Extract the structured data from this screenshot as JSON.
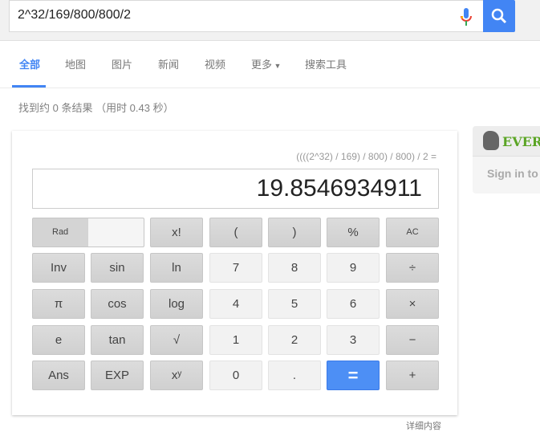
{
  "search": {
    "query": "2^32/169/800/800/2"
  },
  "tabs": [
    {
      "label": "全部"
    },
    {
      "label": "地图"
    },
    {
      "label": "图片"
    },
    {
      "label": "新闻"
    },
    {
      "label": "视频"
    },
    {
      "label": "更多"
    },
    {
      "label": "搜索工具"
    }
  ],
  "stats": "找到约 0 条结果 （用时 0.43 秒）",
  "calculator": {
    "expression": "((((2^32) / 169) / 800) / 800) / 2 =",
    "result": "19.8546934911",
    "keys": [
      [
        "Rad",
        "",
        "x!",
        "(",
        ")",
        "%",
        "AC"
      ],
      [
        "Inv",
        "sin",
        "ln",
        "7",
        "8",
        "9",
        "÷"
      ],
      [
        "π",
        "cos",
        "log",
        "4",
        "5",
        "6",
        "×"
      ],
      [
        "e",
        "tan",
        "√",
        "1",
        "2",
        "3",
        "−"
      ],
      [
        "Ans",
        "EXP",
        "xʸ",
        "0",
        ".",
        "=",
        "+"
      ]
    ],
    "accent": "#4d8ff5"
  },
  "footer": "详细内容",
  "evernote": {
    "brand": "EVERNOTE",
    "signin": "Sign in to"
  }
}
